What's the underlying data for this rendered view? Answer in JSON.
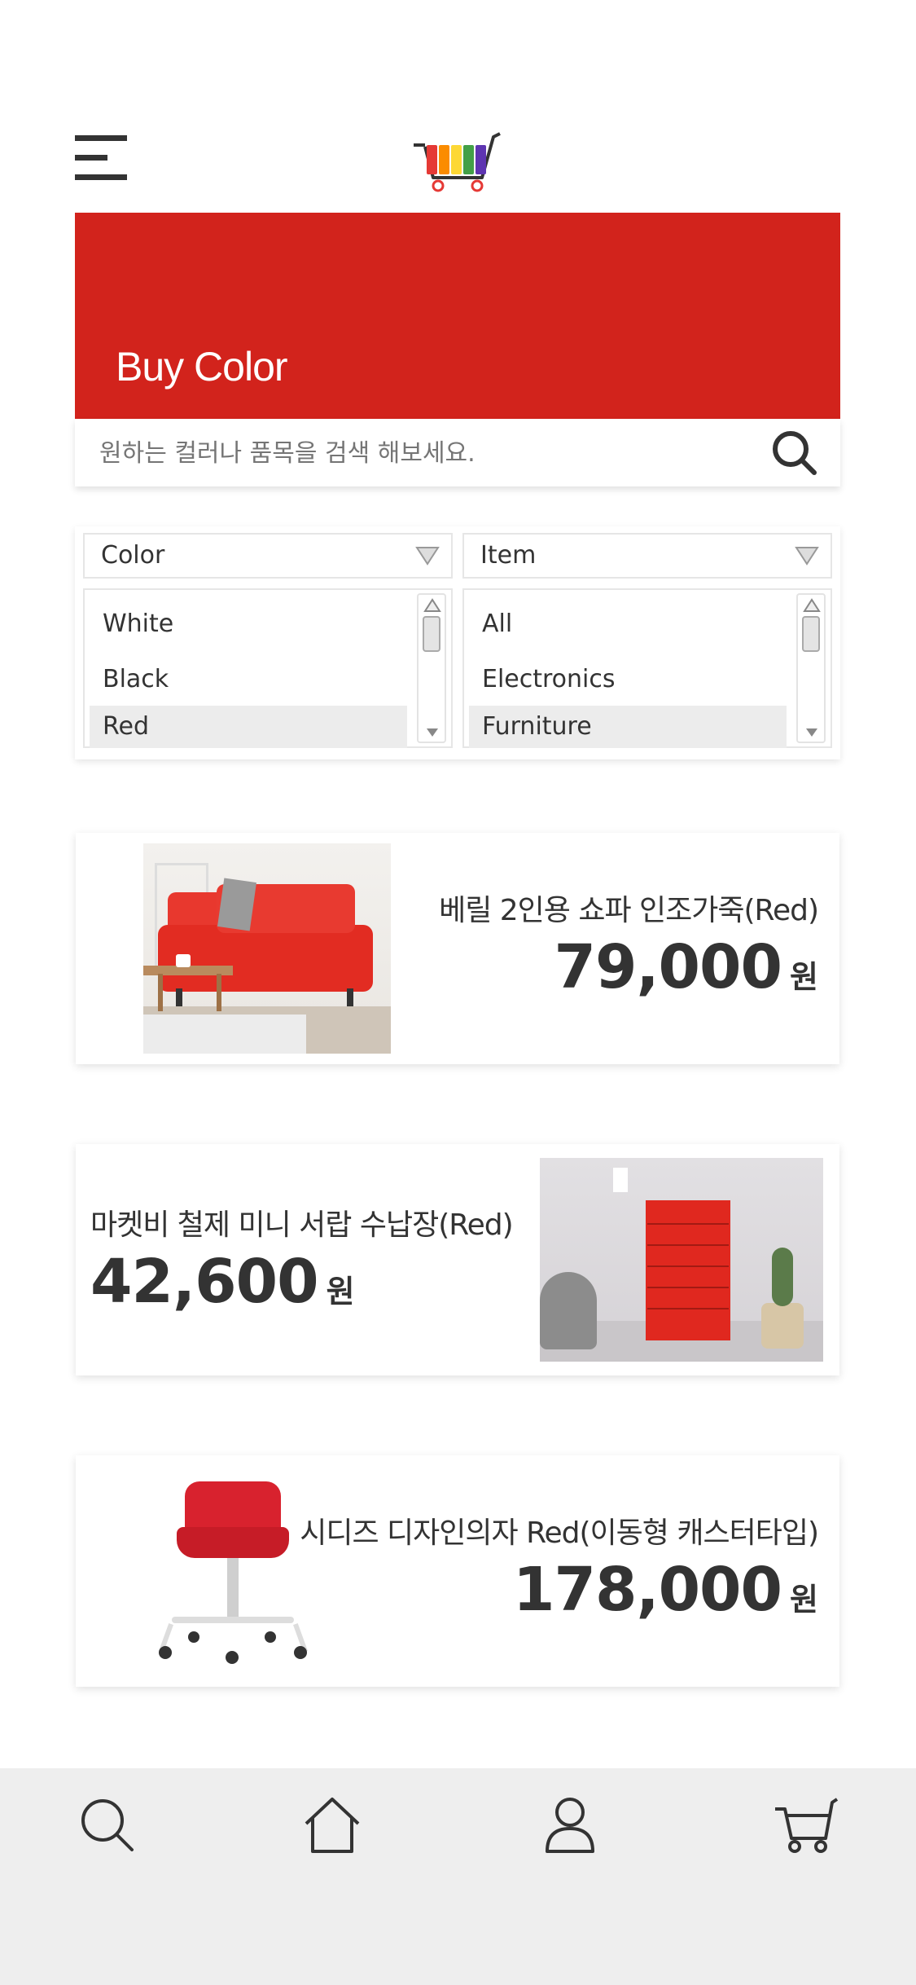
{
  "header": {
    "menu_icon": "hamburger-menu-icon",
    "logo_icon": "rainbow-cart-logo"
  },
  "banner": {
    "title": "Buy Color",
    "color": "#d2231c"
  },
  "search": {
    "placeholder": "원하는 컬러나 품목을 검색 해보세요.",
    "icon": "search-icon"
  },
  "filters": {
    "color": {
      "label": "Color",
      "options": [
        "White",
        "Black",
        "Red"
      ],
      "selected": "Red"
    },
    "item": {
      "label": "Item",
      "options": [
        "All",
        "Electronics",
        "Furniture"
      ],
      "selected": "Furniture"
    }
  },
  "products": [
    {
      "title": "베릴 2인용 쇼파 인조가죽(Red)",
      "price": "79,000",
      "currency": "원",
      "image": "red-sofa-photo"
    },
    {
      "title": "마켓비 철제 미니 서랍 수납장(Red)",
      "price": "42,600",
      "currency": "원",
      "image": "red-drawer-cabinet-photo"
    },
    {
      "title": "시디즈 디자인의자 Red(이동형 캐스터타입)",
      "price": "178,000",
      "currency": "원",
      "image": "red-office-chair-photo"
    }
  ],
  "bottom_nav": {
    "items": [
      "search-icon",
      "home-icon",
      "user-icon",
      "cart-icon"
    ],
    "background": "#eeeeee"
  }
}
